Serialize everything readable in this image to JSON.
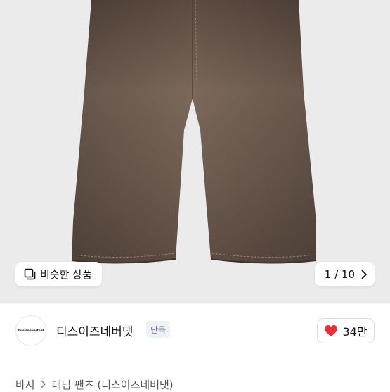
{
  "gallery": {
    "similar_label": "비슷한 상품",
    "similar_icon": "similar-items-icon",
    "counter": "1 / 10",
    "next_icon": "chevron-right-icon",
    "image_alt_color": "#6e5a4e"
  },
  "brand": {
    "logo_text": "thisisneverthat",
    "name": "디스이즈네버댓",
    "badge": "단독",
    "likes": "34만",
    "heart_color": "#e8303a"
  },
  "breadcrumb": {
    "items": [
      "바지",
      "데님 팬츠 (디스이즈네버댓)"
    ]
  }
}
